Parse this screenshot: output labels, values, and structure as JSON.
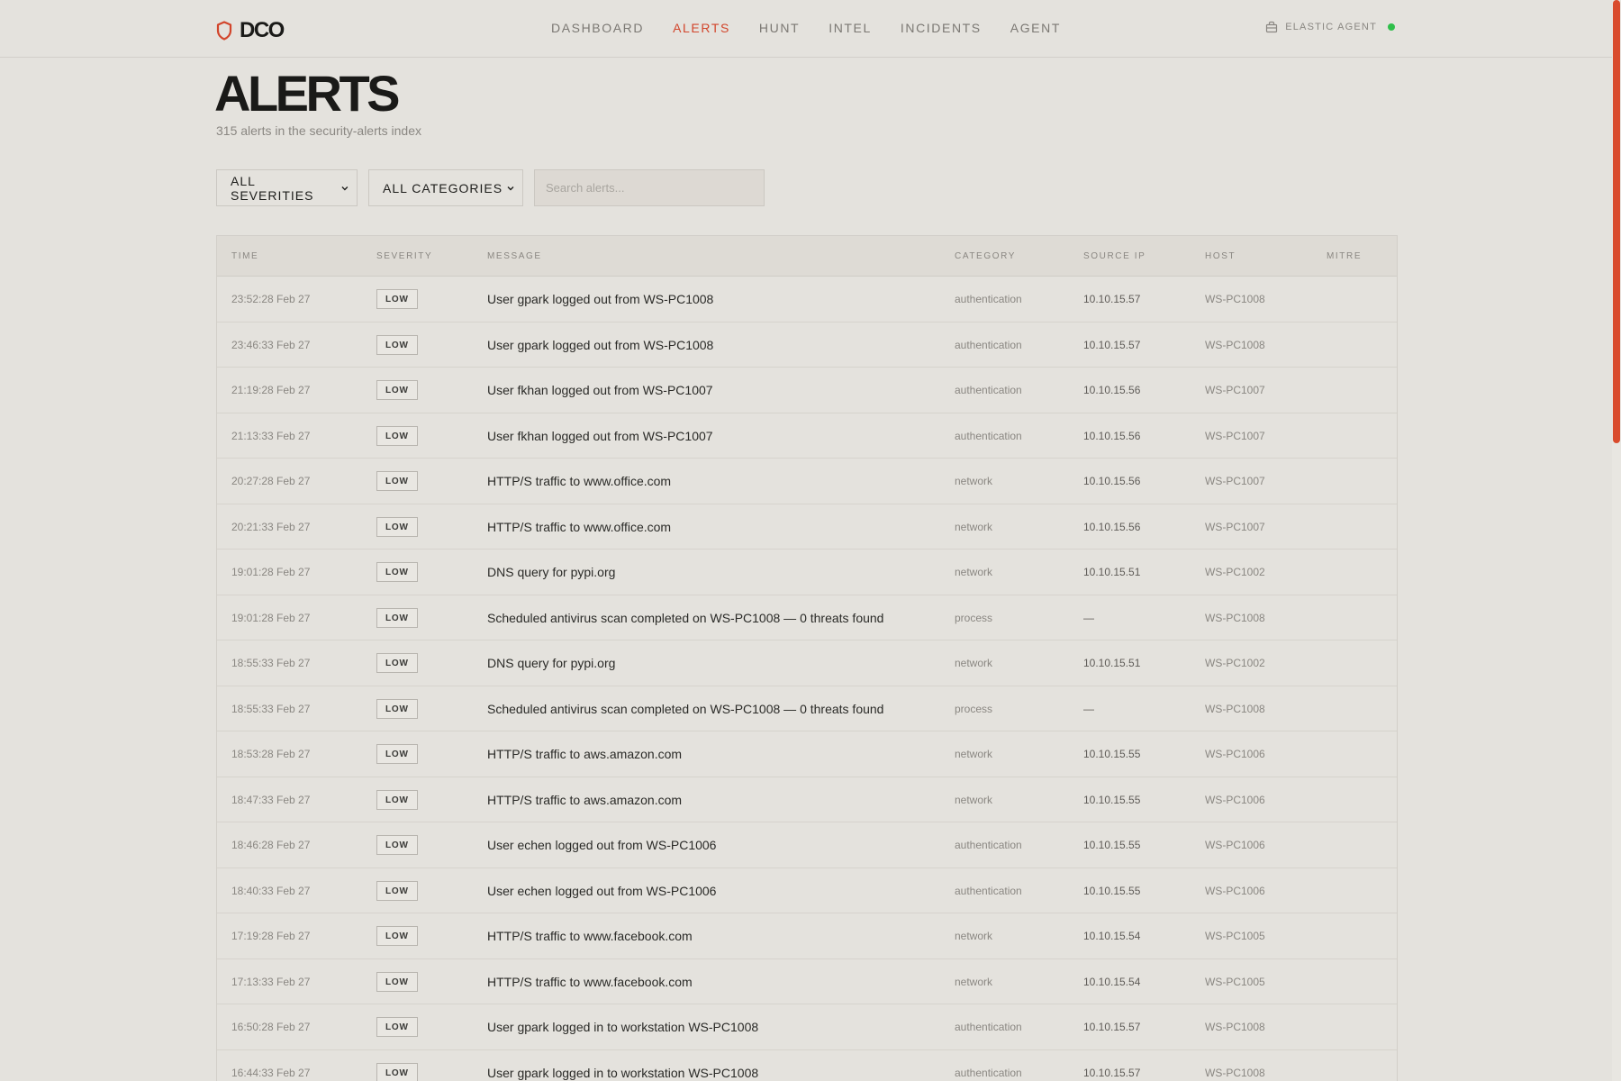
{
  "brand": {
    "name": "DCO",
    "icon": "shield-icon"
  },
  "nav": {
    "items": [
      {
        "label": "DASHBOARD",
        "active": false
      },
      {
        "label": "ALERTS",
        "active": true
      },
      {
        "label": "HUNT",
        "active": false
      },
      {
        "label": "INTEL",
        "active": false
      },
      {
        "label": "INCIDENTS",
        "active": false
      },
      {
        "label": "AGENT",
        "active": false
      }
    ]
  },
  "agent": {
    "label": "ELASTIC AGENT",
    "icon": "agent-bag-icon",
    "status_color": "#2fbf4a"
  },
  "page": {
    "title": "ALERTS",
    "subtitle": "315 alerts in the security-alerts index"
  },
  "filters": {
    "severity": "ALL SEVERITIES",
    "category": "ALL CATEGORIES",
    "search_placeholder": "Search alerts..."
  },
  "table": {
    "columns": [
      "TIME",
      "SEVERITY",
      "MESSAGE",
      "CATEGORY",
      "SOURCE IP",
      "HOST",
      "MITRE"
    ],
    "rows": [
      {
        "time": "23:52:28 Feb 27",
        "severity": "LOW",
        "message": "User gpark logged out from WS-PC1008",
        "category": "authentication",
        "source_ip": "10.10.15.57",
        "host": "WS-PC1008",
        "mitre": ""
      },
      {
        "time": "23:46:33 Feb 27",
        "severity": "LOW",
        "message": "User gpark logged out from WS-PC1008",
        "category": "authentication",
        "source_ip": "10.10.15.57",
        "host": "WS-PC1008",
        "mitre": ""
      },
      {
        "time": "21:19:28 Feb 27",
        "severity": "LOW",
        "message": "User fkhan logged out from WS-PC1007",
        "category": "authentication",
        "source_ip": "10.10.15.56",
        "host": "WS-PC1007",
        "mitre": ""
      },
      {
        "time": "21:13:33 Feb 27",
        "severity": "LOW",
        "message": "User fkhan logged out from WS-PC1007",
        "category": "authentication",
        "source_ip": "10.10.15.56",
        "host": "WS-PC1007",
        "mitre": ""
      },
      {
        "time": "20:27:28 Feb 27",
        "severity": "LOW",
        "message": "HTTP/S traffic to www.office.com",
        "category": "network",
        "source_ip": "10.10.15.56",
        "host": "WS-PC1007",
        "mitre": ""
      },
      {
        "time": "20:21:33 Feb 27",
        "severity": "LOW",
        "message": "HTTP/S traffic to www.office.com",
        "category": "network",
        "source_ip": "10.10.15.56",
        "host": "WS-PC1007",
        "mitre": ""
      },
      {
        "time": "19:01:28 Feb 27",
        "severity": "LOW",
        "message": "DNS query for pypi.org",
        "category": "network",
        "source_ip": "10.10.15.51",
        "host": "WS-PC1002",
        "mitre": ""
      },
      {
        "time": "19:01:28 Feb 27",
        "severity": "LOW",
        "message": "Scheduled antivirus scan completed on WS-PC1008 — 0 threats found",
        "category": "process",
        "source_ip": "—",
        "host": "WS-PC1008",
        "mitre": ""
      },
      {
        "time": "18:55:33 Feb 27",
        "severity": "LOW",
        "message": "DNS query for pypi.org",
        "category": "network",
        "source_ip": "10.10.15.51",
        "host": "WS-PC1002",
        "mitre": ""
      },
      {
        "time": "18:55:33 Feb 27",
        "severity": "LOW",
        "message": "Scheduled antivirus scan completed on WS-PC1008 — 0 threats found",
        "category": "process",
        "source_ip": "—",
        "host": "WS-PC1008",
        "mitre": ""
      },
      {
        "time": "18:53:28 Feb 27",
        "severity": "LOW",
        "message": "HTTP/S traffic to aws.amazon.com",
        "category": "network",
        "source_ip": "10.10.15.55",
        "host": "WS-PC1006",
        "mitre": ""
      },
      {
        "time": "18:47:33 Feb 27",
        "severity": "LOW",
        "message": "HTTP/S traffic to aws.amazon.com",
        "category": "network",
        "source_ip": "10.10.15.55",
        "host": "WS-PC1006",
        "mitre": ""
      },
      {
        "time": "18:46:28 Feb 27",
        "severity": "LOW",
        "message": "User echen logged out from WS-PC1006",
        "category": "authentication",
        "source_ip": "10.10.15.55",
        "host": "WS-PC1006",
        "mitre": ""
      },
      {
        "time": "18:40:33 Feb 27",
        "severity": "LOW",
        "message": "User echen logged out from WS-PC1006",
        "category": "authentication",
        "source_ip": "10.10.15.55",
        "host": "WS-PC1006",
        "mitre": ""
      },
      {
        "time": "17:19:28 Feb 27",
        "severity": "LOW",
        "message": "HTTP/S traffic to www.facebook.com",
        "category": "network",
        "source_ip": "10.10.15.54",
        "host": "WS-PC1005",
        "mitre": ""
      },
      {
        "time": "17:13:33 Feb 27",
        "severity": "LOW",
        "message": "HTTP/S traffic to www.facebook.com",
        "category": "network",
        "source_ip": "10.10.15.54",
        "host": "WS-PC1005",
        "mitre": ""
      },
      {
        "time": "16:50:28 Feb 27",
        "severity": "LOW",
        "message": "User gpark logged in to workstation WS-PC1008",
        "category": "authentication",
        "source_ip": "10.10.15.57",
        "host": "WS-PC1008",
        "mitre": ""
      },
      {
        "time": "16:44:33 Feb 27",
        "severity": "LOW",
        "message": "User gpark logged in to workstation WS-PC1008",
        "category": "authentication",
        "source_ip": "10.10.15.57",
        "host": "WS-PC1008",
        "mitre": ""
      }
    ]
  },
  "colors": {
    "accent": "#d2452b",
    "background": "#e4e2dd"
  }
}
